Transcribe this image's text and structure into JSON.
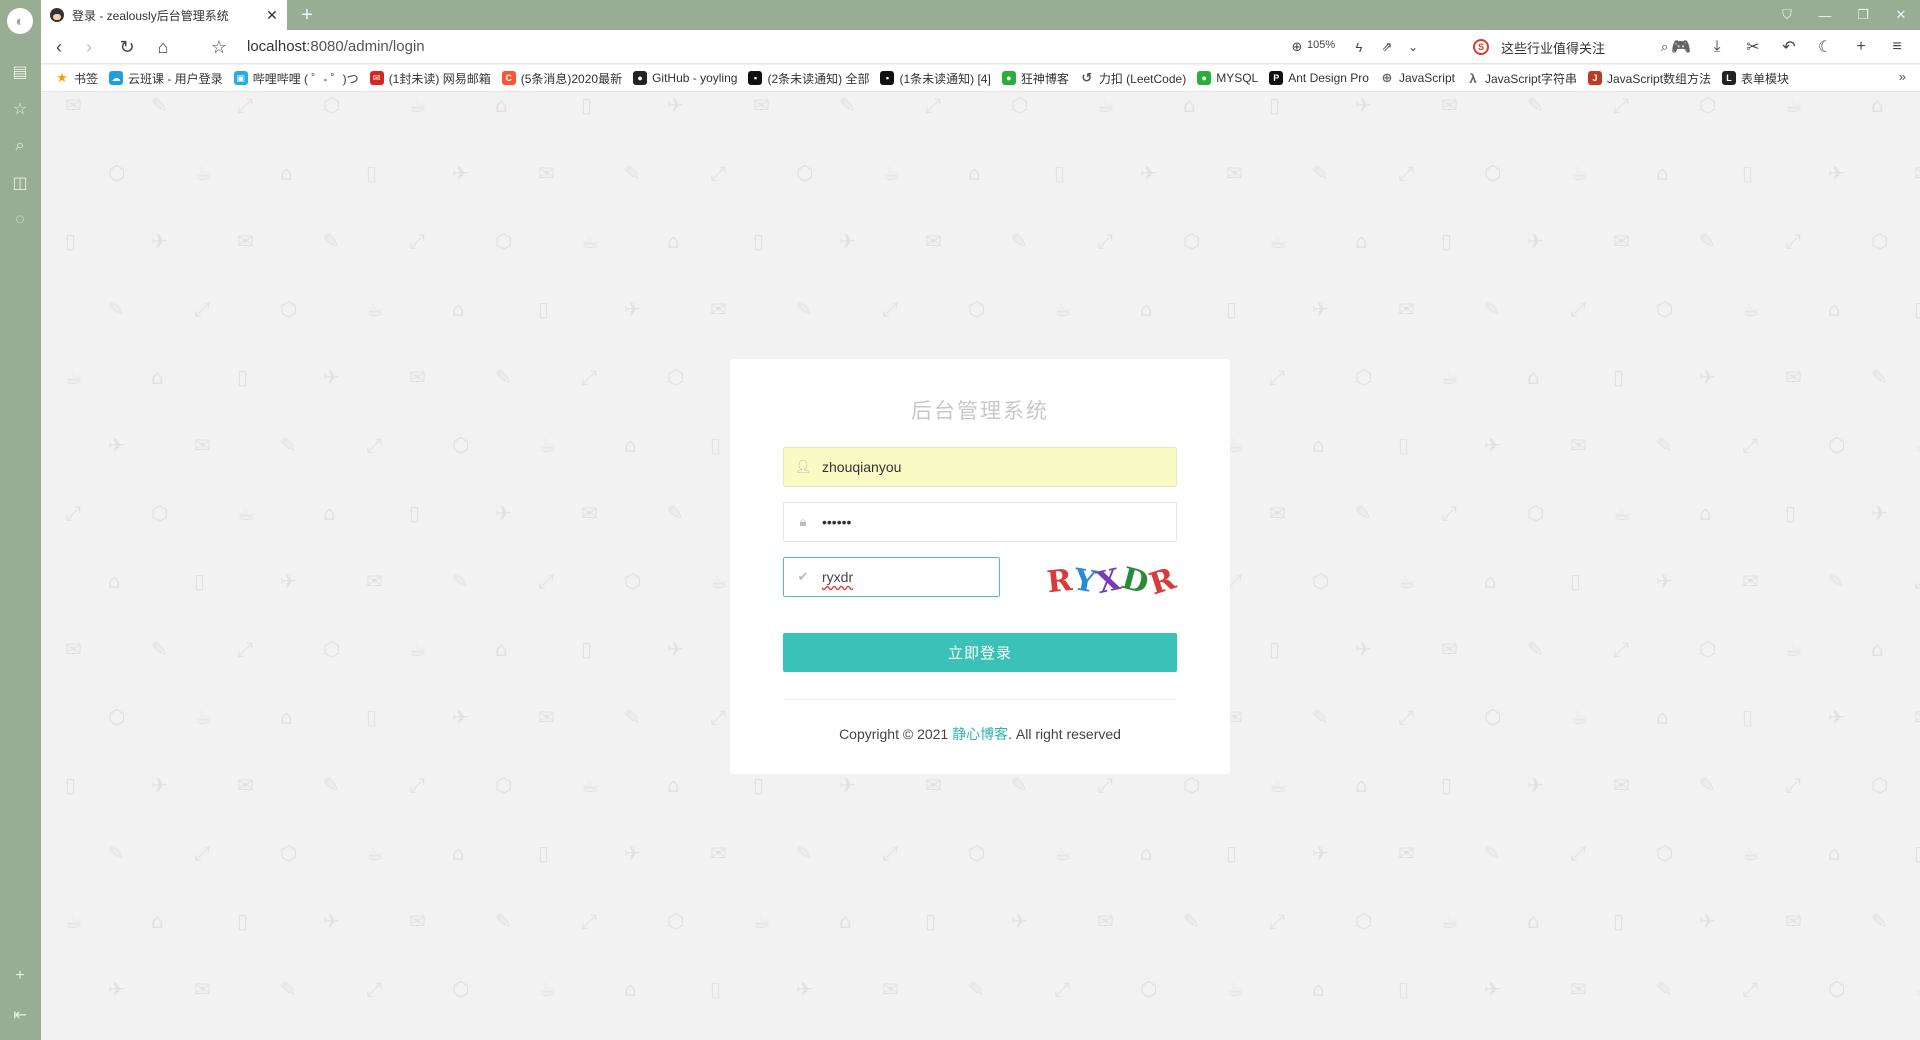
{
  "browser": {
    "tab_title": "登录 - zealously后台管理系统",
    "url_host": "localhost",
    "url_rest": ":8080/admin/login",
    "zoom": "105%",
    "search_hint": "这些行业值得关注",
    "bookmarks": [
      {
        "label": "书签",
        "icon": "star-icon",
        "color": "#f0a000"
      },
      {
        "label": "云班课 - 用户登录",
        "icon": "cloud-class-icon",
        "color": "#1ca0e0"
      },
      {
        "label": "哔哩哔哩 ( ゜- ゜)つ",
        "icon": "bilibili-icon",
        "color": "#23ade5"
      },
      {
        "label": "(1封未读) 网易邮箱",
        "icon": "netease-mail-icon",
        "color": "#d6261f"
      },
      {
        "label": "(5条消息)2020最新",
        "icon": "csdn-icon",
        "color": "#fc5531"
      },
      {
        "label": "GitHub - yoyling",
        "icon": "github-icon",
        "color": "#222222"
      },
      {
        "label": "(2条未读通知) 全部",
        "icon": "notification-icon",
        "color": "#111111"
      },
      {
        "label": "(1条未读通知) [4]",
        "icon": "notification-icon",
        "color": "#111111"
      },
      {
        "label": "狂神博客",
        "icon": "wechat-icon",
        "color": "#2bae3b"
      },
      {
        "label": "力扣 (LeetCode)",
        "icon": "leetcode-icon",
        "color": "#555555"
      },
      {
        "label": "MYSQL",
        "icon": "wechat-icon",
        "color": "#2bae3b"
      },
      {
        "label": "Ant Design Pro",
        "icon": "pro-icon",
        "color": "#111111"
      },
      {
        "label": "JavaScript",
        "icon": "globe-icon",
        "color": "#666666"
      },
      {
        "label": "JavaScript字符串",
        "icon": "lambda-icon",
        "color": "#666666"
      },
      {
        "label": "JavaScript数组方法",
        "icon": "js-icon",
        "color": "#c03a20"
      },
      {
        "label": "表单模块",
        "icon": "layui-icon",
        "color": "#222222"
      }
    ]
  },
  "login": {
    "title": "后台管理系统",
    "username": "zhouqianyou",
    "password_mask": "••••••",
    "captcha_input": "ryxdr",
    "captcha_text": "RYXDR",
    "captcha_colors": [
      "#d93a3a",
      "#2a8ad8",
      "#7a3ab8",
      "#2a8a3a",
      "#d93a3a"
    ],
    "login_button": "立即登录",
    "copyright_prefix": "Copyright © 2021 ",
    "copyright_link": "静心博客",
    "copyright_suffix": ". All right reserved"
  }
}
